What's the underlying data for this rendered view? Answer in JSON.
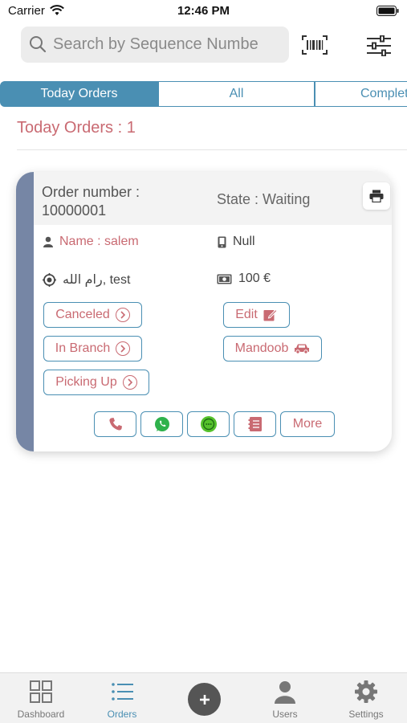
{
  "status_bar": {
    "carrier": "Carrier",
    "time": "12:46 PM"
  },
  "search": {
    "placeholder": "Search by Sequence Numbe"
  },
  "tabs": [
    {
      "label": "Today Orders",
      "active": true
    },
    {
      "label": "All",
      "active": false
    },
    {
      "label": "Complet",
      "active": false
    }
  ],
  "section": {
    "title": "Today Orders : 1"
  },
  "order": {
    "number_label": "Order number :",
    "number": "10000001",
    "state": "State : Waiting",
    "name": "Name : salem",
    "phone": "Null",
    "address": "رام الله, test",
    "amount": "100 €",
    "status_buttons": [
      "Canceled",
      "In Branch",
      "Picking Up"
    ],
    "right_buttons": [
      "Edit",
      "Mandoob"
    ],
    "more_label": "More"
  },
  "tab_bar": [
    {
      "label": "Dashboard",
      "active": false
    },
    {
      "label": "Orders",
      "active": true
    },
    {
      "label": "Users",
      "active": false
    },
    {
      "label": "Settings",
      "active": false
    }
  ],
  "colors": {
    "accent": "#4a8fb3",
    "rose": "#c96a72",
    "card_stripe": "#7686a5",
    "whatsapp": "#2fb24c"
  }
}
